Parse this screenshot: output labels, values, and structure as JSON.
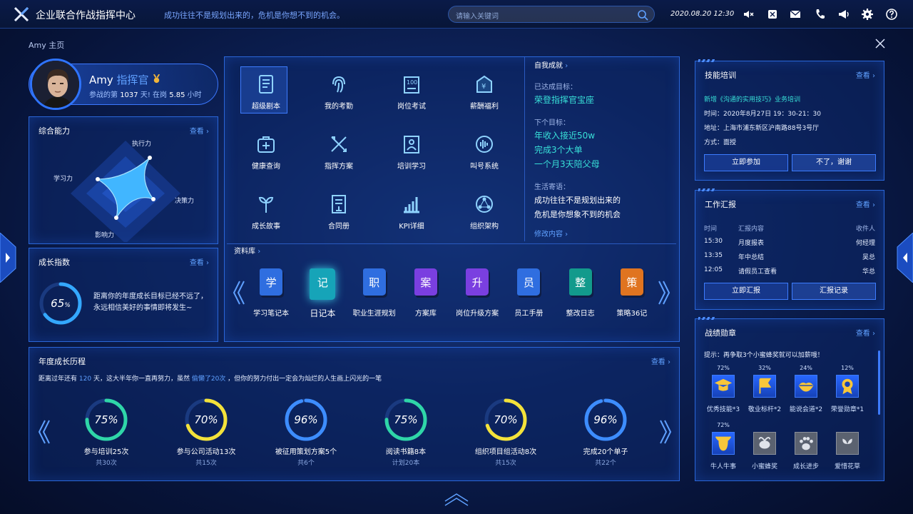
{
  "header": {
    "title": "企业联合作战指挥中心",
    "slogan": "成功往往不是规划出来的，危机是你想不到的机会。",
    "search_placeholder": "请输入关键词",
    "datetime": "2020.08.20  12:30",
    "icons": [
      "mute-icon",
      "translate-icon",
      "mail-icon",
      "phone-icon",
      "broadcast-icon",
      "gear-icon",
      "help-icon"
    ]
  },
  "breadcrumb": "Amy 主页",
  "profile": {
    "name": "Amy",
    "role": "指挥官",
    "stat_prefix": "参战的第",
    "days": "1037",
    "days_unit": "天!  在岗",
    "hours": "5.85",
    "hours_unit": "小时"
  },
  "ability": {
    "title": "综合能力",
    "more": "查看 ›",
    "axes": [
      "执行力",
      "决策力",
      "影响力",
      "学习力"
    ]
  },
  "growth": {
    "title": "成长指数",
    "more": "查看 ›",
    "percent": "65",
    "percent_value": 65,
    "text": "距离你的年度成长目标已经不远了，永远相信美好的事情即将发生~"
  },
  "modules": [
    {
      "label": "超级剧本",
      "icon": "script-icon",
      "name": "module-super-script"
    },
    {
      "label": "我的考勤",
      "icon": "fingerprint-icon",
      "name": "module-attendance"
    },
    {
      "label": "岗位考试",
      "icon": "exam-icon",
      "name": "module-exam"
    },
    {
      "label": "薪酬福利",
      "icon": "salary-icon",
      "name": "module-salary"
    },
    {
      "label": "健康查询",
      "icon": "medical-kit-icon",
      "name": "module-health"
    },
    {
      "label": "指挥方案",
      "icon": "tools-icon",
      "name": "module-plan"
    },
    {
      "label": "培训学习",
      "icon": "training-icon",
      "name": "module-training"
    },
    {
      "label": "叫号系统",
      "icon": "voice-icon",
      "name": "module-call"
    },
    {
      "label": "成长故事",
      "icon": "sprout-icon",
      "name": "module-story"
    },
    {
      "label": "合同册",
      "icon": "contract-icon",
      "name": "module-contract"
    },
    {
      "label": "KPI详细",
      "icon": "bar-chart-icon",
      "name": "module-kpi"
    },
    {
      "label": "组织架构",
      "icon": "org-icon",
      "name": "module-org"
    }
  ],
  "achievement": {
    "title": "自我成就",
    "reached_label": "已达成目标：",
    "reached": "荣登指挥官宝座",
    "next_label": "下个目标：",
    "next": [
      "年收入接近50w",
      "完成3个大单",
      "一个月3天陪父母"
    ],
    "motto_label": "生活寄语：",
    "motto": [
      "成功往往不是规划出来的",
      "危机是你想象不到的机会"
    ],
    "edit": "修改内容 ›"
  },
  "library": {
    "title": "资料库",
    "books": [
      {
        "char": "学",
        "label": "学习笔记本",
        "color": "#2f6ee0"
      },
      {
        "char": "记",
        "label": "日记本",
        "color": "#16a4b8"
      },
      {
        "char": "职",
        "label": "职业生涯规划",
        "color": "#2f6ee0"
      },
      {
        "char": "案",
        "label": "方案库",
        "color": "#7a3fe0"
      },
      {
        "char": "升",
        "label": "岗位升级方案",
        "color": "#7a3fe0"
      },
      {
        "char": "员",
        "label": "员工手册",
        "color": "#2f6ee0"
      },
      {
        "char": "整",
        "label": "整改日志",
        "color": "#129a8c"
      },
      {
        "char": "策",
        "label": "策略36记",
        "color": "#e07420"
      }
    ]
  },
  "annual": {
    "title": "年度成长历程",
    "more": "查看 ›",
    "intro_a": "距离过年还有",
    "days_left": "120",
    "intro_b": "天，这大半年你一直再努力，虽然",
    "lazy": "偷懒了20次",
    "intro_c": "，但你的努力付出一定会为灿烂的人生画上闪光的一笔",
    "rings": [
      {
        "pct": "75%",
        "value": 75,
        "label": "参与培训25次",
        "sub": "共30次",
        "color": "#2fd6a8"
      },
      {
        "pct": "70%",
        "value": 70,
        "label": "参与公司活动13次",
        "sub": "共15次",
        "color": "#f3e23a"
      },
      {
        "pct": "96%",
        "value": 96,
        "label": "被征用策划方案5个",
        "sub": "共6个",
        "color": "#3d8dff"
      },
      {
        "pct": "75%",
        "value": 75,
        "label": "阅读书籍8本",
        "sub": "计划20本",
        "color": "#2fd6a8"
      },
      {
        "pct": "70%",
        "value": 70,
        "label": "组织项目组活动8次",
        "sub": "共15次",
        "color": "#f3e23a"
      },
      {
        "pct": "96%",
        "value": 96,
        "label": "完成20个单子",
        "sub": "共22个",
        "color": "#3d8dff"
      }
    ]
  },
  "skill": {
    "title": "技能培训",
    "more": "查看 ›",
    "course": "新增《沟通的实用技巧》业务培训",
    "time": "时间：2020年8月27日 19：30-21：30",
    "addr": "地址：上海市浦东新区沪南路88号3号厅",
    "mode": "方式：面授",
    "join": "立即参加",
    "decline": "不了，谢谢"
  },
  "report": {
    "title": "工作汇报",
    "more": "查看 ›",
    "headers": [
      "时间",
      "汇报内容",
      "收件人"
    ],
    "rows": [
      [
        "15:30",
        "月度报表",
        "何经理"
      ],
      [
        "13:35",
        "年中总结",
        "吴总"
      ],
      [
        "12:05",
        "请假员工查看",
        "华总"
      ]
    ],
    "report_btn": "立即汇报",
    "record_btn": "汇报记录"
  },
  "medals": {
    "title": "战绩勋章",
    "more": "查看 ›",
    "tip": "提示：再争取3个小蜜蜂奖就可以加薪哦！",
    "items": [
      {
        "pct": "72%",
        "label": "优秀技能*3",
        "icon": "graduation-cap-icon",
        "on": true
      },
      {
        "pct": "32%",
        "label": "敬业标杆*2",
        "icon": "flag-icon",
        "on": true
      },
      {
        "pct": "24%",
        "label": "能说会道*2",
        "icon": "lips-icon",
        "on": true
      },
      {
        "pct": "12%",
        "label": "荣誉勋章*1",
        "icon": "rosette-icon",
        "on": true
      },
      {
        "pct": "72%",
        "label": "牛人牛事",
        "icon": "bull-icon",
        "on": true
      },
      {
        "pct": "",
        "label": "小蜜蜂奖",
        "icon": "bee-icon",
        "on": false
      },
      {
        "pct": "",
        "label": "成长进步",
        "icon": "paw-icon",
        "on": false
      },
      {
        "pct": "",
        "label": "爱惜花草",
        "icon": "flower-icon",
        "on": false
      }
    ]
  }
}
